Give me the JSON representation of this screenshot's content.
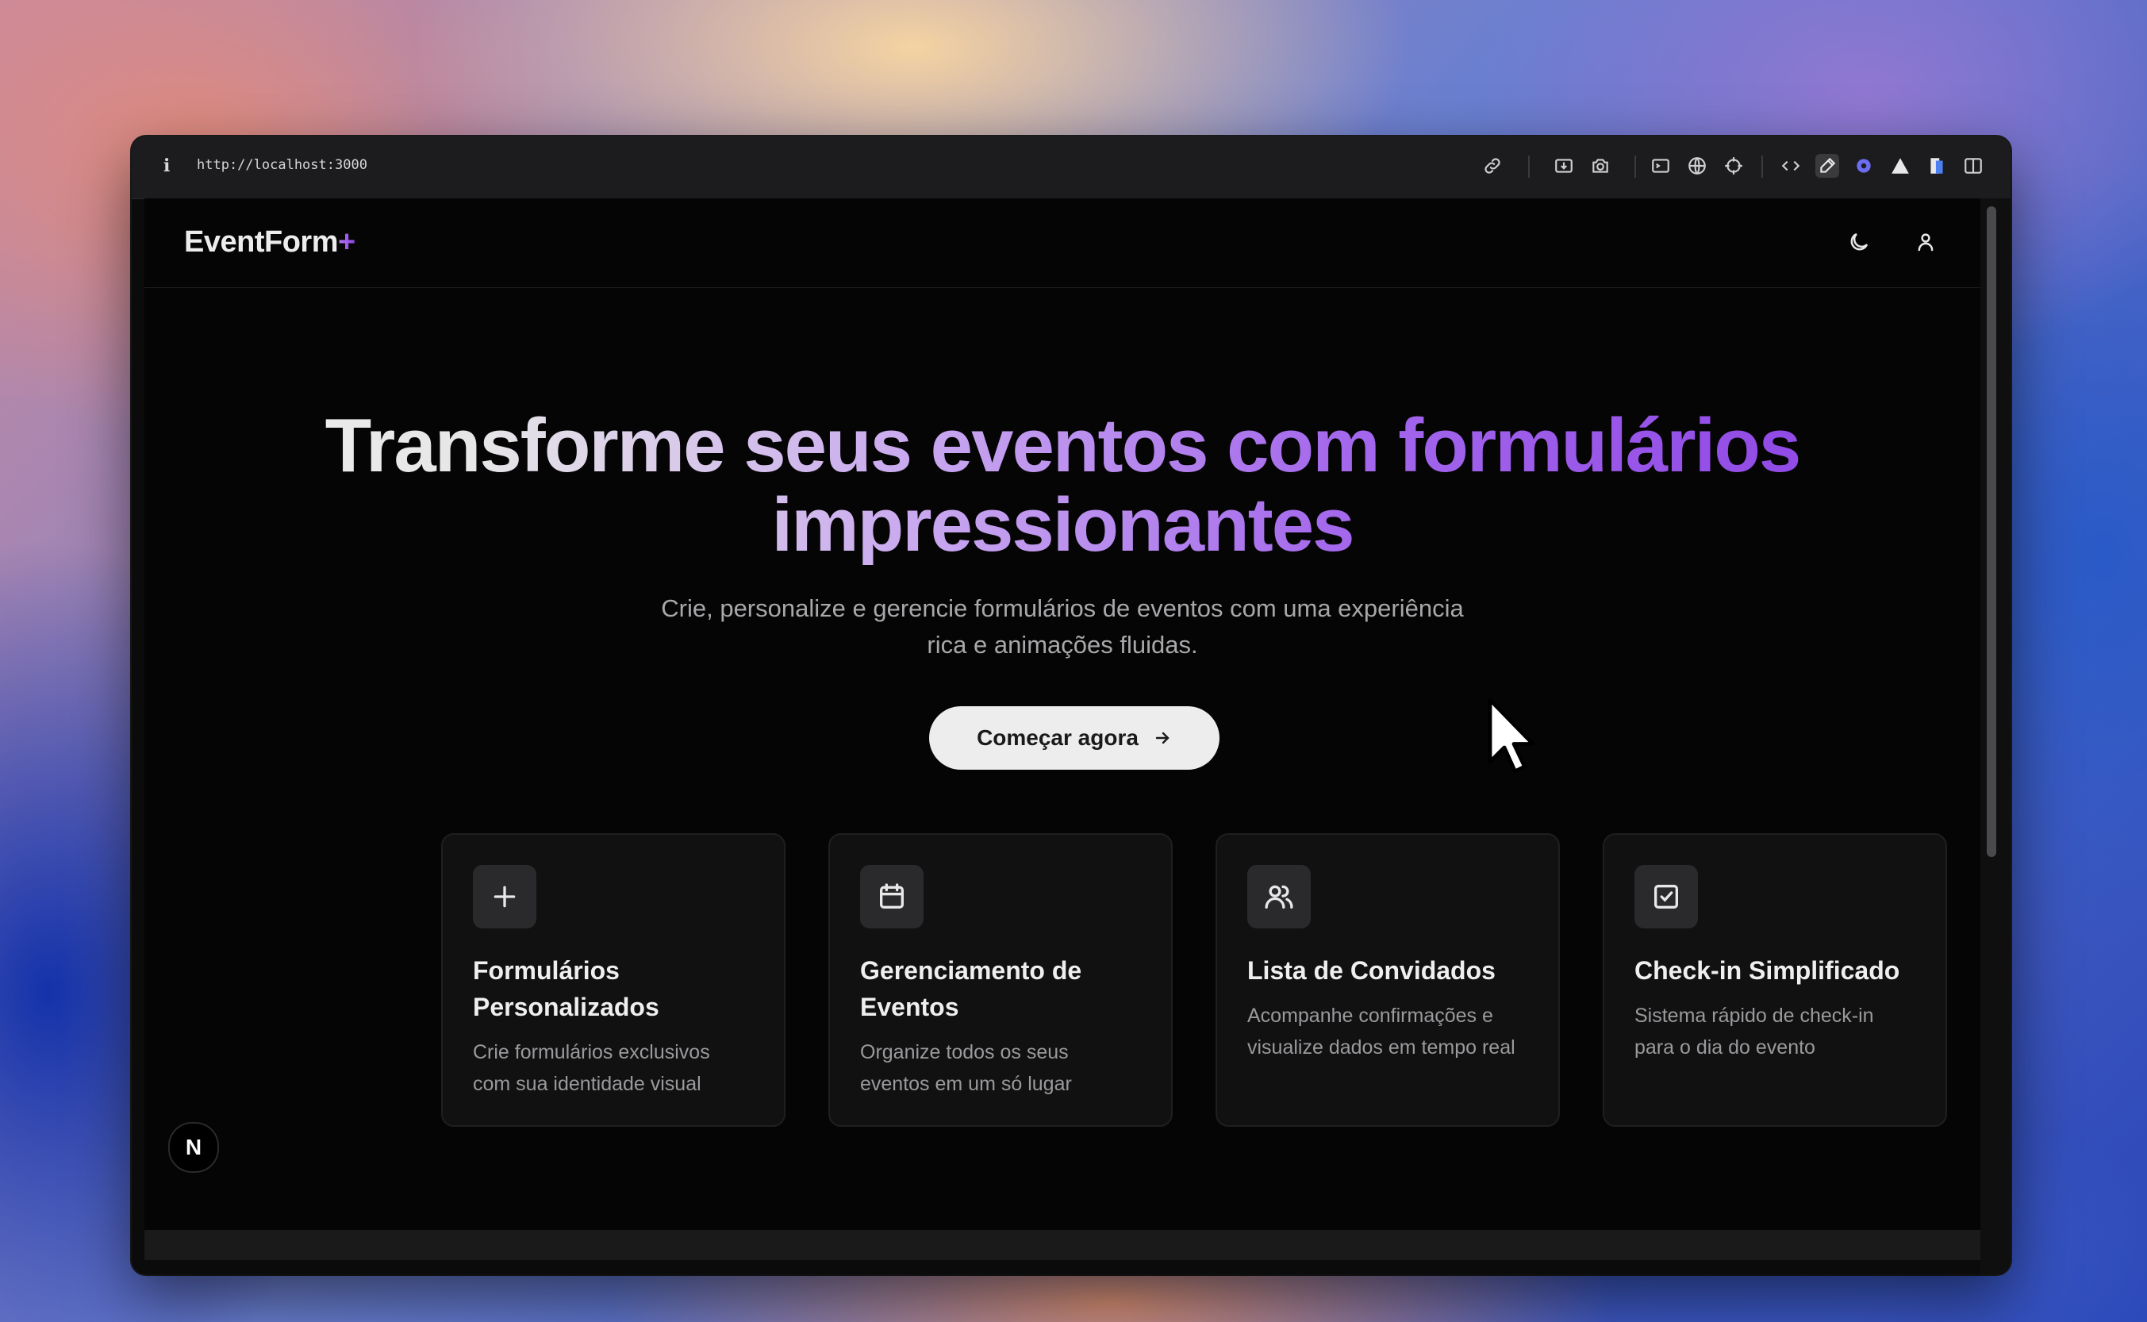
{
  "browser": {
    "url": "http://localhost:3000",
    "toolbar_icons": [
      "link-icon",
      "download-icon",
      "camera-icon",
      "terminal-icon",
      "globe-icon",
      "crosshair-icon",
      "code-icon",
      "eyedropper-icon",
      "gear-icon",
      "triangle-icon",
      "book-icon",
      "sidebar-icon"
    ]
  },
  "header": {
    "brand_part1": "EventForm",
    "brand_part2": "+",
    "theme_toggle_icon": "moon-icon",
    "user_icon": "user-icon"
  },
  "hero": {
    "title_line1": "Transforme seus eventos com formulários",
    "title_line2": "impressionantes",
    "subtitle": "Crie, personalize e gerencie formulários de eventos com uma experiência rica e animações fluidas.",
    "cta_label": "Começar agora"
  },
  "features": [
    {
      "icon": "plus-icon",
      "title": "Formulários Personalizados",
      "description": "Crie formulários exclusivos com sua identidade visual"
    },
    {
      "icon": "calendar-icon",
      "title": "Gerenciamento de Eventos",
      "description": "Organize todos os seus eventos em um só lugar"
    },
    {
      "icon": "users-icon",
      "title": "Lista de Convidados",
      "description": "Acompanhe confirmações e visualize dados em tempo real"
    },
    {
      "icon": "check-square-icon",
      "title": "Check-in Simplificado",
      "description": "Sistema rápido de check-in para o dia do evento"
    }
  ],
  "dev_badge": "N",
  "colors": {
    "background": "#050505",
    "accent": "#8b3fe6",
    "cta_bg": "#ededed"
  }
}
